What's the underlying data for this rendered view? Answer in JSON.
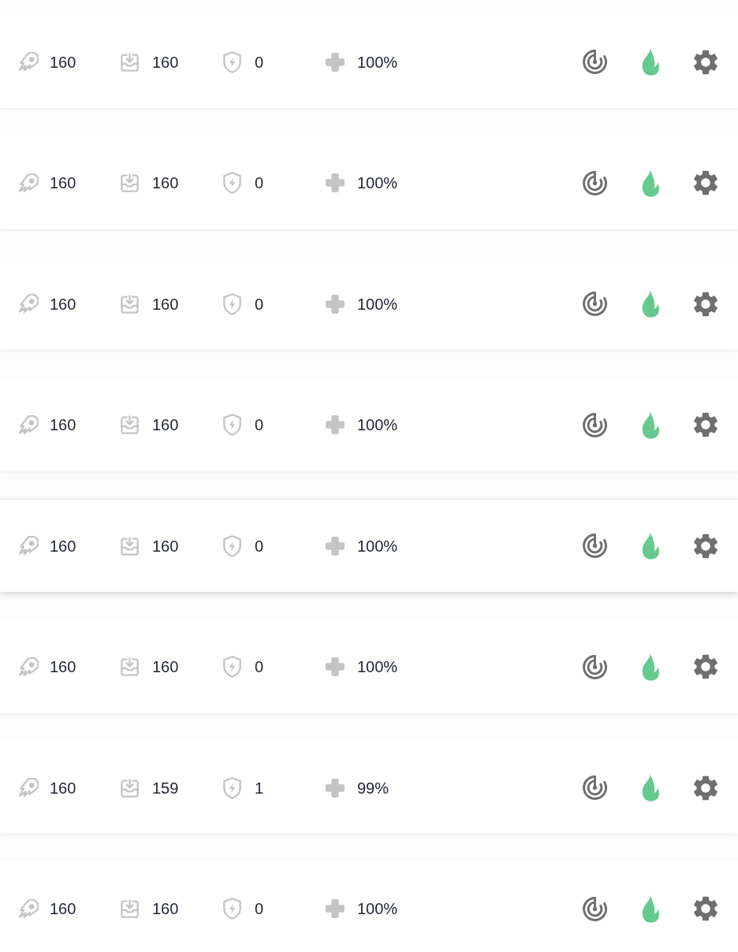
{
  "rows": [
    {
      "highlighted": false,
      "stats": [
        {
          "kind": "comet",
          "value": "160"
        },
        {
          "kind": "tray",
          "value": "160"
        },
        {
          "kind": "shield",
          "value": "0"
        },
        {
          "kind": "plus",
          "value": "100%"
        }
      ]
    },
    {
      "highlighted": false,
      "stats": [
        {
          "kind": "comet",
          "value": "160"
        },
        {
          "kind": "tray",
          "value": "160"
        },
        {
          "kind": "shield",
          "value": "0"
        },
        {
          "kind": "plus",
          "value": "100%"
        }
      ]
    },
    {
      "highlighted": false,
      "stats": [
        {
          "kind": "comet",
          "value": "160"
        },
        {
          "kind": "tray",
          "value": "160"
        },
        {
          "kind": "shield",
          "value": "0"
        },
        {
          "kind": "plus",
          "value": "100%"
        }
      ]
    },
    {
      "highlighted": false,
      "stats": [
        {
          "kind": "comet",
          "value": "160"
        },
        {
          "kind": "tray",
          "value": "160"
        },
        {
          "kind": "shield",
          "value": "0"
        },
        {
          "kind": "plus",
          "value": "100%"
        }
      ]
    },
    {
      "highlighted": true,
      "stats": [
        {
          "kind": "comet",
          "value": "160"
        },
        {
          "kind": "tray",
          "value": "160"
        },
        {
          "kind": "shield",
          "value": "0"
        },
        {
          "kind": "plus",
          "value": "100%"
        }
      ]
    },
    {
      "highlighted": false,
      "stats": [
        {
          "kind": "comet",
          "value": "160"
        },
        {
          "kind": "tray",
          "value": "160"
        },
        {
          "kind": "shield",
          "value": "0"
        },
        {
          "kind": "plus",
          "value": "100%"
        }
      ]
    },
    {
      "highlighted": false,
      "stats": [
        {
          "kind": "comet",
          "value": "160"
        },
        {
          "kind": "tray",
          "value": "159"
        },
        {
          "kind": "shield",
          "value": "1"
        },
        {
          "kind": "plus",
          "value": "99%"
        }
      ]
    },
    {
      "highlighted": false,
      "stats": [
        {
          "kind": "comet",
          "value": "160"
        },
        {
          "kind": "tray",
          "value": "160"
        },
        {
          "kind": "shield",
          "value": "0"
        },
        {
          "kind": "plus",
          "value": "100%"
        }
      ]
    }
  ]
}
